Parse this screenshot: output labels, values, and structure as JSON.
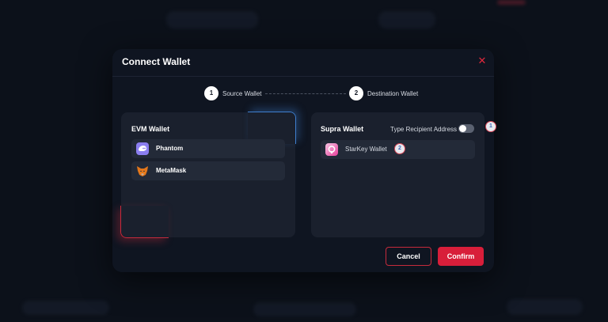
{
  "modal": {
    "title": "Connect Wallet",
    "close_icon": "close-icon"
  },
  "steps": [
    {
      "number": "1",
      "label": "Source Wallet"
    },
    {
      "number": "2",
      "label": "Destination Wallet"
    }
  ],
  "source_panel": {
    "title": "EVM Wallet",
    "wallets": [
      {
        "name": "Phantom",
        "icon": "phantom-icon",
        "color": "#8b7ef0"
      },
      {
        "name": "MetaMask",
        "icon": "metamask-fox-icon",
        "color": "#e2761b"
      }
    ]
  },
  "destination_panel": {
    "title": "Supra Wallet",
    "toggle_label": "Type Recipient Address",
    "toggle_on": false,
    "wallets": [
      {
        "name": "StarKey Wallet",
        "icon": "starkey-icon",
        "color": "#e83e9a"
      }
    ]
  },
  "markers": [
    "1",
    "2"
  ],
  "buttons": {
    "cancel": "Cancel",
    "confirm": "Confirm"
  },
  "colors": {
    "accent": "#d81e3a",
    "panel": "#1a202d",
    "modal": "#0f1521",
    "glow_blue": "#3f7fcf",
    "glow_red": "#c62a3c"
  }
}
